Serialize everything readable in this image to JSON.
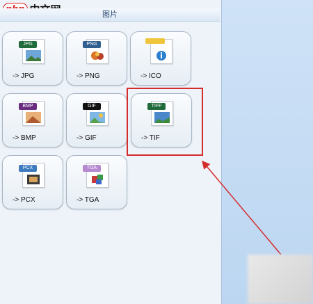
{
  "logo": {
    "php": "php",
    "cn": "中文网"
  },
  "header": {
    "title": "图片"
  },
  "tiles": [
    {
      "tag": "JPG",
      "label": "-> JPG"
    },
    {
      "tag": "PNG",
      "label": "-> PNG"
    },
    {
      "tag": "",
      "label": "-> ICO"
    },
    {
      "tag": "BMP",
      "label": "-> BMP"
    },
    {
      "tag": "GIF",
      "label": "-> GIF"
    },
    {
      "tag": "TIFF",
      "label": "-> TIF"
    },
    {
      "tag": "PCX",
      "label": "-> PCX"
    },
    {
      "tag": "TGA",
      "label": "-> TGA"
    }
  ],
  "colors": {
    "highlight": "#d42b2b",
    "panel_bg": "#eef3f9",
    "right_pane_bg": "#c6dcf3"
  }
}
